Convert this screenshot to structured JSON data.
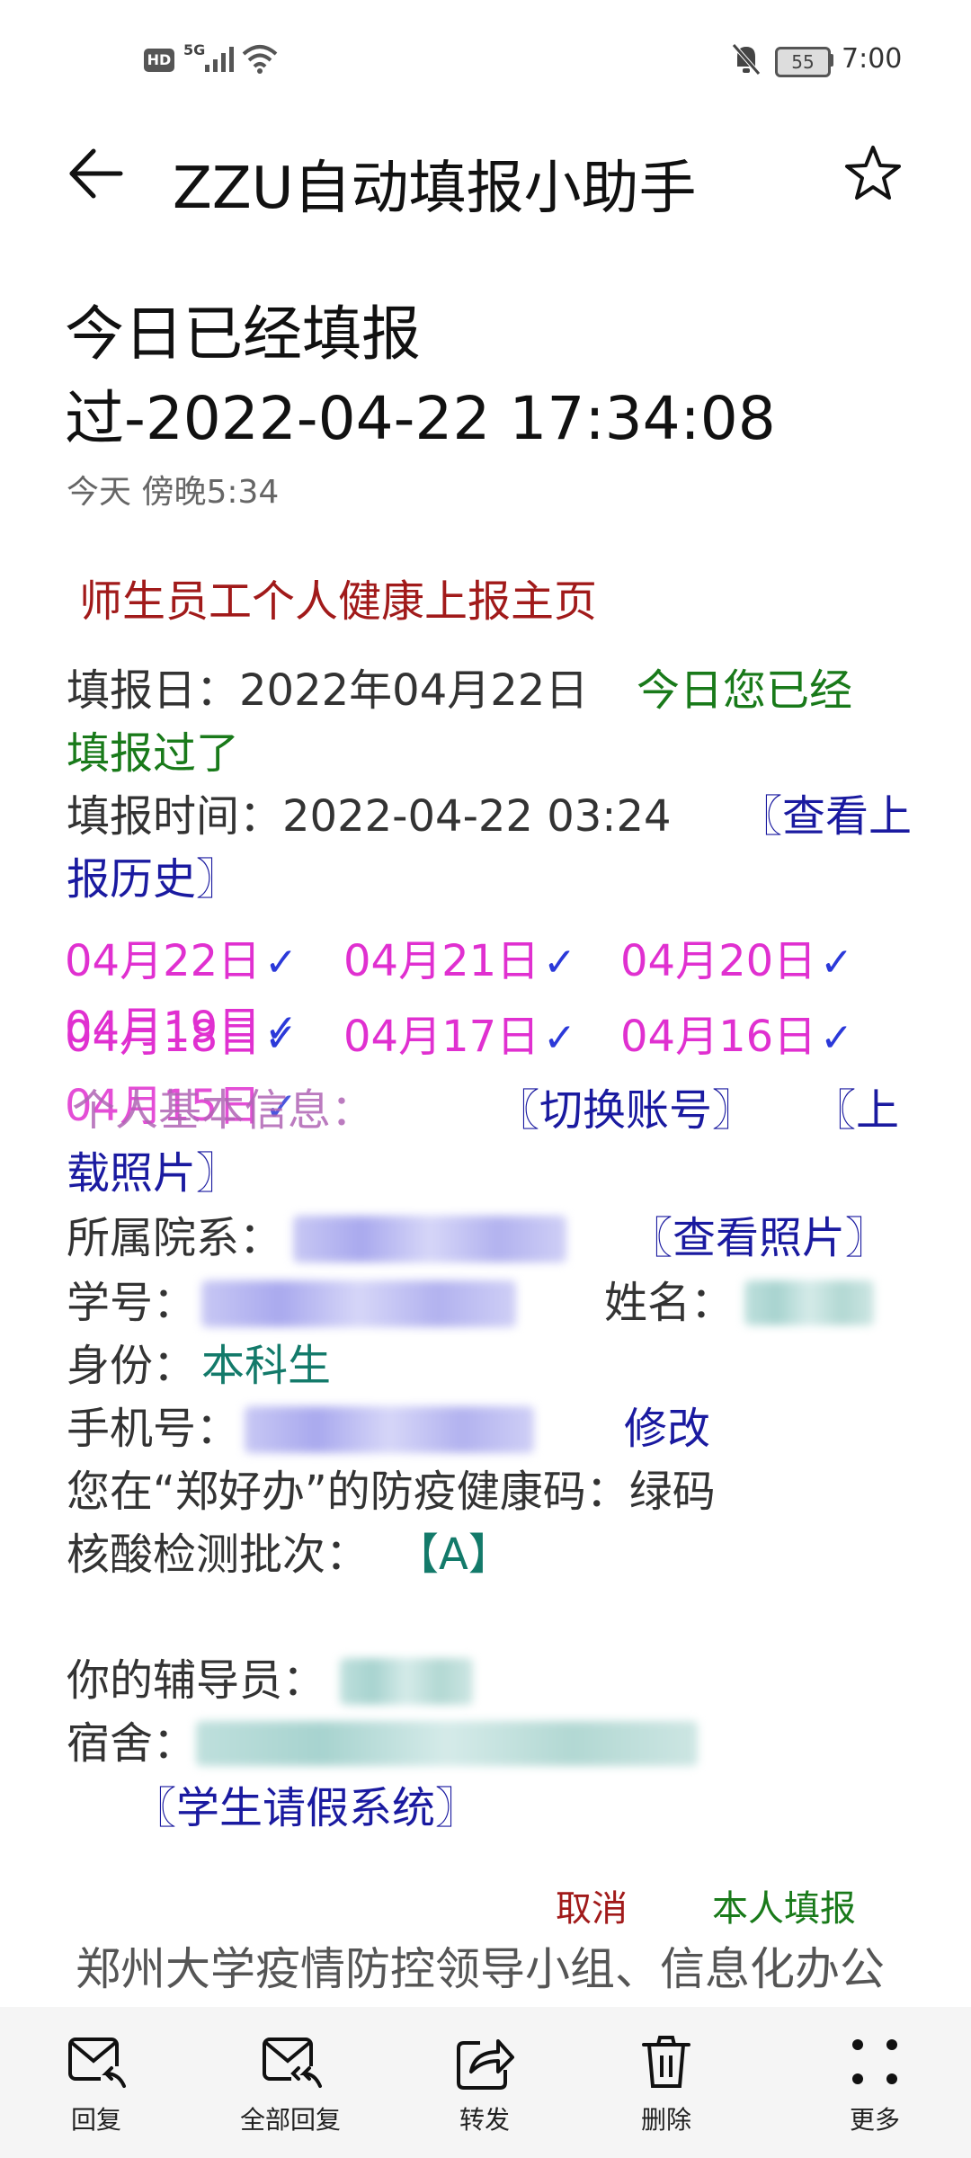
{
  "status_bar": {
    "left_icons": [
      "hd-icon",
      "5g-signal-icon",
      "wifi-icon"
    ],
    "hd_text": "HD",
    "net_text": "5G",
    "battery": "55",
    "time": "7:00"
  },
  "header": {
    "title": "ZZU自动填报小助手"
  },
  "message": {
    "subject_line1": "今日已经填报",
    "subject_line2": "过-2022-04-22 17:34:08",
    "received": "今天 傍晚5:34"
  },
  "body": {
    "page_title": "师生员工个人健康上报主页",
    "report_date_label": "填报日：",
    "report_date": "2022年04月22日",
    "already_reported_1": "今日您已经",
    "already_reported_2": "填报过了",
    "report_time_label": "填报时间：",
    "report_time": "2022-04-22 03:24",
    "history_link_1": "〖查看上",
    "history_link_2": "报历史〗",
    "history_dates": [
      "04月22日",
      "04月21日",
      "04月20日",
      "04月19日",
      "04月18日",
      "04月17日",
      "04月16日",
      "04月15日"
    ],
    "check_mark": "✓",
    "personal_info_label": "个人基本信息：",
    "switch_account": "〖切换账号〗",
    "upload_photo_1": "〖上",
    "upload_photo_2": "载照片〗",
    "department_label": "所属院系：",
    "view_photo": "〖查看照片〗",
    "student_id_label": "学号：",
    "name_label": "姓名：",
    "identity_label": "身份：",
    "identity_value": "本科生",
    "phone_label": "手机号：",
    "modify_link": "修改",
    "health_code_label": "您在“郑好办”的防疫健康码：",
    "health_code_value": "绿码",
    "nucleic_label": "核酸检测批次：",
    "nucleic_value": "【A】",
    "counselor_label": "你的辅导员：",
    "dorm_label": "宿舍：",
    "leave_system": "〖学生请假系统〗",
    "cancel": "取消",
    "self_report": "本人填报",
    "footer": "郑州大学疫情防控领导小组、信息化办公"
  },
  "toolbar": {
    "reply": "回复",
    "reply_all": "全部回复",
    "forward": "转发",
    "delete": "删除",
    "more": "更多"
  },
  "colors": {
    "title_red": "#a11a1a",
    "green": "#197a1a",
    "link_blue": "#1a1aa0",
    "date_magenta": "#e030d0",
    "teal": "#137a6a"
  }
}
